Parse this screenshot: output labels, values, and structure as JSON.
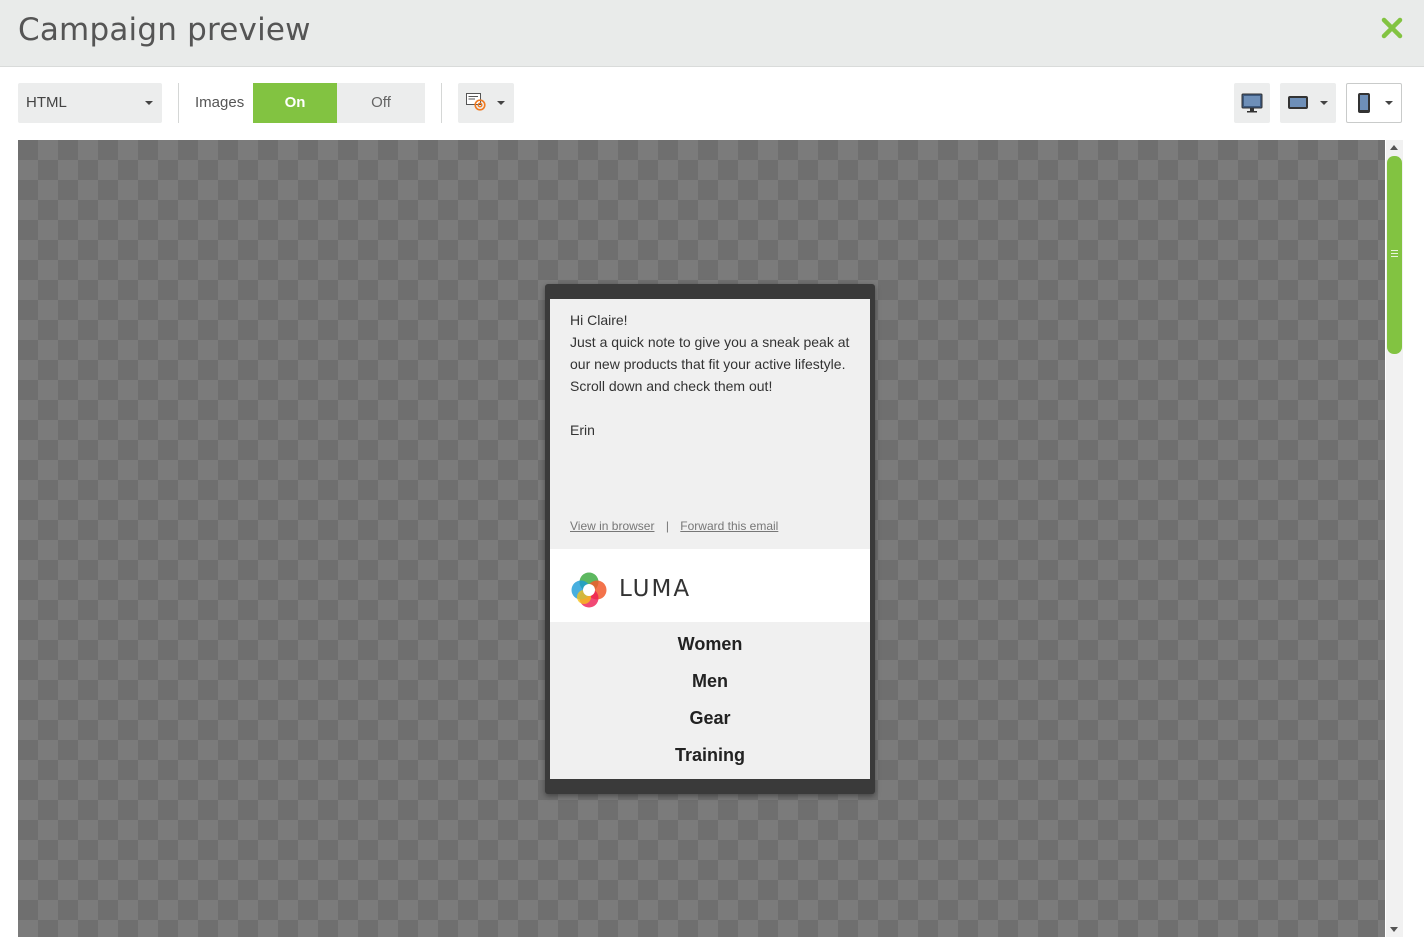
{
  "window": {
    "title": "Campaign preview"
  },
  "toolbar": {
    "format_select": {
      "value": "HTML"
    },
    "images_label": "Images",
    "images_toggle": {
      "on_label": "On",
      "off_label": "Off",
      "selected": "On"
    },
    "colors": {
      "accent": "#82c341"
    }
  },
  "email": {
    "greeting": "Hi Claire!",
    "body_lines": [
      "Just a quick note to give you a sneak peak at",
      "our new products that fit your active lifestyle.",
      "Scroll down and check them out!"
    ],
    "signature": "Erin",
    "view_in_browser": "View in browser",
    "separator": "|",
    "forward_email": "Forward this email",
    "brand": "LUMA",
    "nav": [
      "Women",
      "Men",
      "Gear",
      "Training"
    ]
  },
  "icons": [
    "close-icon",
    "email-client-icon",
    "desktop-icon",
    "tablet-landscape-icon",
    "phone-portrait-icon"
  ]
}
